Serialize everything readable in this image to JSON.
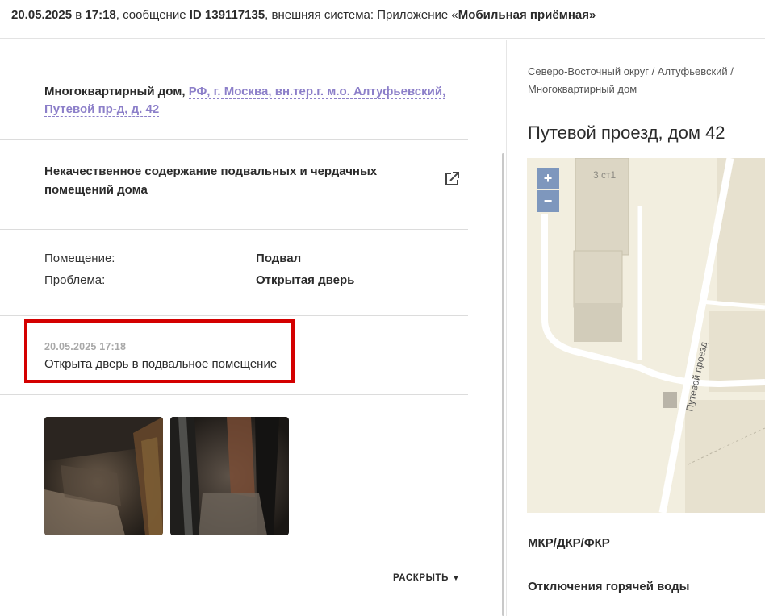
{
  "header": {
    "date": "20.05.2025",
    "at": " в ",
    "time": "17:18",
    "msg_prefix": ", сообщение ",
    "msg_id": "ID 139117135",
    "system_prefix": ", внешняя система: Приложение «",
    "system_name": "Мобильная приёмная",
    "system_suffix": "»"
  },
  "address": {
    "kind": "Многоквартирный дом,",
    "link_line1": "РФ, г. Москва, вн.тер.г. м.о. Алтуфьевский,",
    "link_line2": "Путевой пр-д, д. 42"
  },
  "issue": {
    "title": "Некачественное содержание подвальных и чердачных помещений дома",
    "icon": "open-external-icon"
  },
  "details": [
    {
      "label": "Помещение:",
      "value": "Подвал"
    },
    {
      "label": "Проблема:",
      "value": "Открытая дверь"
    }
  ],
  "comment": {
    "date": "20.05.2025 17:18",
    "text": "Открыта дверь в подвальное помещение",
    "highlight_color": "#d40000"
  },
  "photos": [
    "photo-1",
    "photo-2"
  ],
  "expand": {
    "label": "РАСКРЫТЬ",
    "icon": "chevron-down-icon"
  },
  "side": {
    "crumbs": "Северо-Восточный округ / Алтуфьевский / Многоквартирный дом",
    "title": "Путевой проезд, дом 42",
    "map": {
      "zoom_in": "+",
      "zoom_out": "−",
      "building_label": "3 ст1",
      "street_label": "Путевой проезд"
    },
    "section1": "МКР/ДКР/ФКР",
    "section2": "Отключения горячей воды"
  },
  "colors": {
    "link": "#8c7fc9",
    "map_bg": "#f2eedf",
    "zoom_btn": "#7e97bd"
  }
}
